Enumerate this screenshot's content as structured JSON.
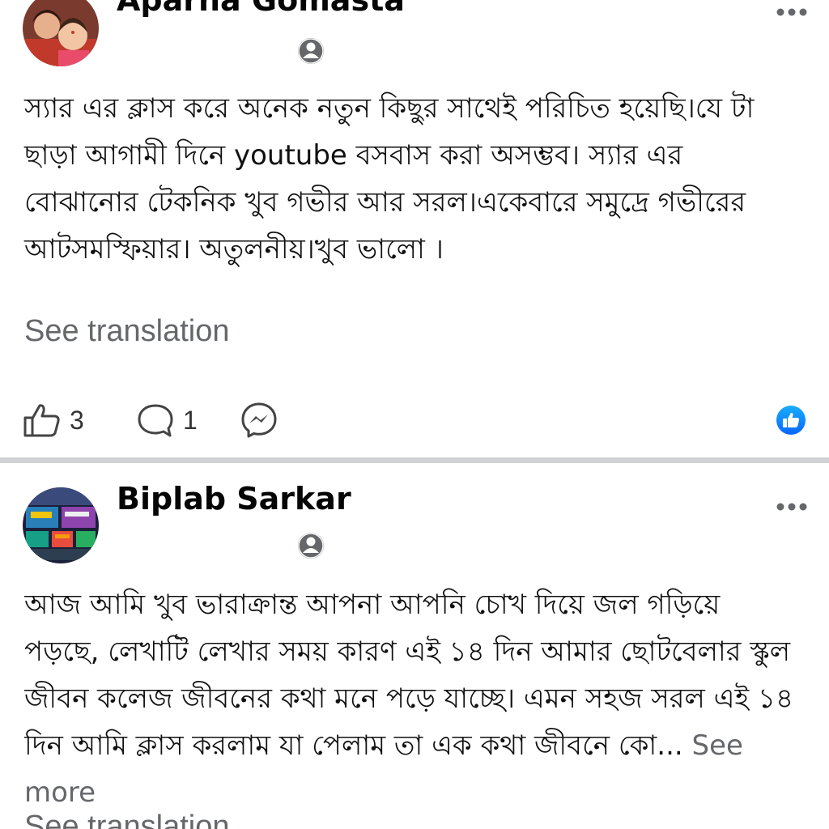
{
  "posts": [
    {
      "author": "Aparna Gomasta",
      "body": "স্যার এর ক্লাস করে অনেক নতুন কিছুর সাথেই পরিচিত হয়েছি।যে টা ছাড়া আগামী দিনে youtube বসবাস করা অসম্ভব। স্যার এর বোঝানোর টেকনিক খুব গভীর আর সরল।একেবারে সমুদ্রে গভীরের আটসমস্ফিয়ার। অতুলনীয়।খুব ভালো ।",
      "see_translation": "See translation",
      "like_count": "3",
      "comment_count": "1",
      "icons": {
        "avatar": "profile-photo",
        "privacy": "friends-privacy-icon",
        "more": "more-options-icon",
        "like": "thumbs-up-icon",
        "comment": "comment-bubble-icon",
        "share": "messenger-icon",
        "reaction": "like-reaction-badge"
      }
    },
    {
      "author": "Biplab Sarkar",
      "body": "আজ আমি খুব ভারাক্রান্ত আপনা আপনি চোখ দিয়ে জল গড়িয়ে পড়ছে, লেখাটি লেখার সময় কারণ এই ১৪ দিন আমার ছোটবেলার স্কুল জীবন কলেজ জীবনের কথা মনে পড়ে যাচ্ছে। এমন সহজ সরল এই ১৪ দিন আমি ক্লাস করলাম যা পেলাম তা এক কথা জীবনে কো...",
      "see_more": "See more",
      "see_translation": "See translation",
      "icons": {
        "avatar": "profile-photo",
        "privacy": "friends-privacy-icon",
        "more": "more-options-icon"
      }
    }
  ],
  "colors": {
    "text": "#111111",
    "secondary_text": "#65676b",
    "divider": "#cfd1d5",
    "facebook_blue": "#1877f2",
    "icon_gray": "#65676b"
  }
}
